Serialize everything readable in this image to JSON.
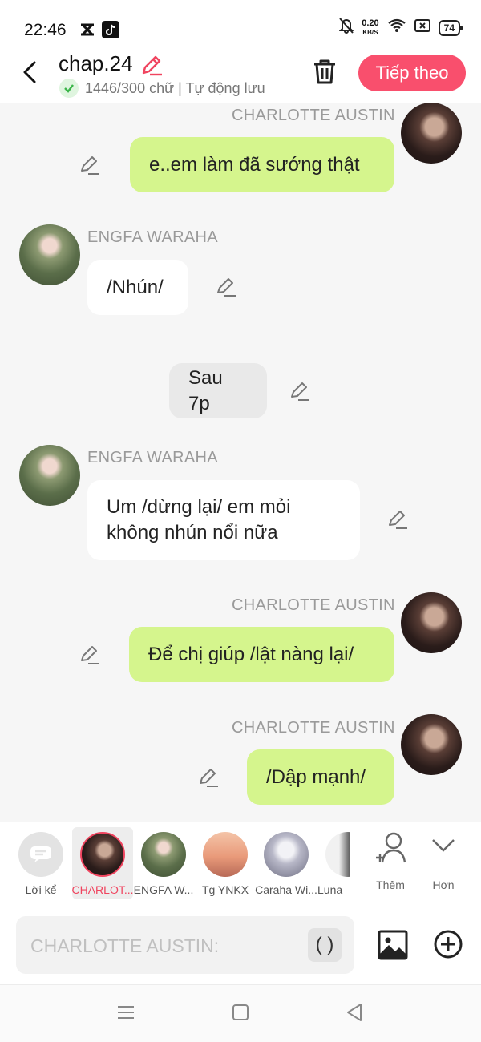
{
  "status": {
    "time": "22:46",
    "net_speed_value": "0.20",
    "net_speed_unit": "KB/S",
    "battery": "74"
  },
  "header": {
    "title": "chap.24",
    "save_status": "1446/300 chữ | Tự động lưu",
    "next_label": "Tiếp theo",
    "accent_color": "#f94f6d"
  },
  "messages": [
    {
      "type": "outgoing",
      "sender": "CHARLOTTE AUSTIN",
      "text": "e..em làm đã sướng thật"
    },
    {
      "type": "incoming",
      "sender": "ENGFA WARAHA",
      "text": "/Nhún/"
    },
    {
      "type": "narration",
      "text": "Sau 7p"
    },
    {
      "type": "incoming",
      "sender": "ENGFA WARAHA",
      "text": "Um /dừng lại/ em mỏi không nhún nổi nữa"
    },
    {
      "type": "outgoing",
      "sender": "CHARLOTTE AUSTIN",
      "text": "Để chị giúp /lật nàng lại/"
    },
    {
      "type": "outgoing",
      "sender": "CHARLOTTE AUSTIN",
      "text": "/Dập mạnh/"
    }
  ],
  "characters": [
    {
      "label": "Lời kể",
      "selected": false
    },
    {
      "label": "CHARLOT...",
      "selected": true
    },
    {
      "label": "ENGFA W...",
      "selected": false
    },
    {
      "label": "Tg YNKX",
      "selected": false
    },
    {
      "label": "Caraha Wi...",
      "selected": false
    },
    {
      "label": "Luna",
      "selected": false
    }
  ],
  "char_actions": {
    "add_label": "Thêm",
    "more_label": "Hơn"
  },
  "input": {
    "placeholder": "CHARLOTTE AUSTIN:",
    "paren_label": "( )"
  }
}
